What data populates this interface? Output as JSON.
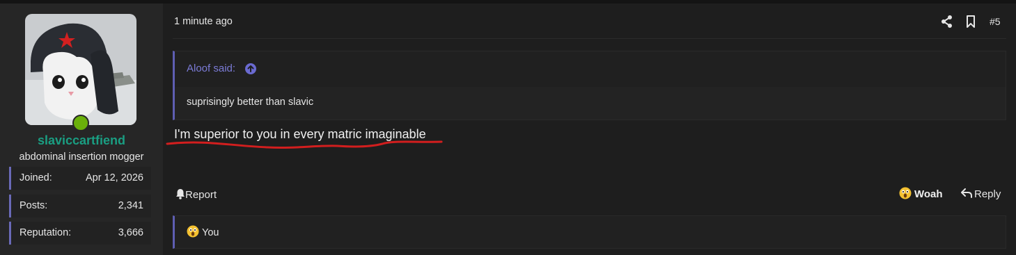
{
  "user": {
    "username": "slaviccartfiend",
    "title": "abdominal insertion mogger",
    "stats": [
      {
        "label": "Joined:",
        "value": "Apr 12, 2026"
      },
      {
        "label": "Posts:",
        "value": "2,341"
      },
      {
        "label": "Reputation:",
        "value": "3,666"
      }
    ]
  },
  "post": {
    "time": "1 minute ago",
    "number": "#5",
    "quote": {
      "author": "Aloof said:",
      "text": "suprisingly better than slavic"
    },
    "message": "I'm superior to you in every matric imaginable",
    "actions": {
      "report": "Report",
      "reaction": "Woah",
      "reply": "Reply"
    },
    "reactions_summary": "You"
  },
  "colors": {
    "username": "#1a9e82",
    "accent_border": "#5e5eb2",
    "quote_author": "#7b7bd6",
    "online": "#6ab00a",
    "underline": "#d21e1e"
  },
  "icons": [
    "share-icon",
    "bookmark-icon",
    "arrow-up-circle-icon",
    "bell-icon",
    "astonished-emoji-icon",
    "reply-arrow-icon"
  ]
}
